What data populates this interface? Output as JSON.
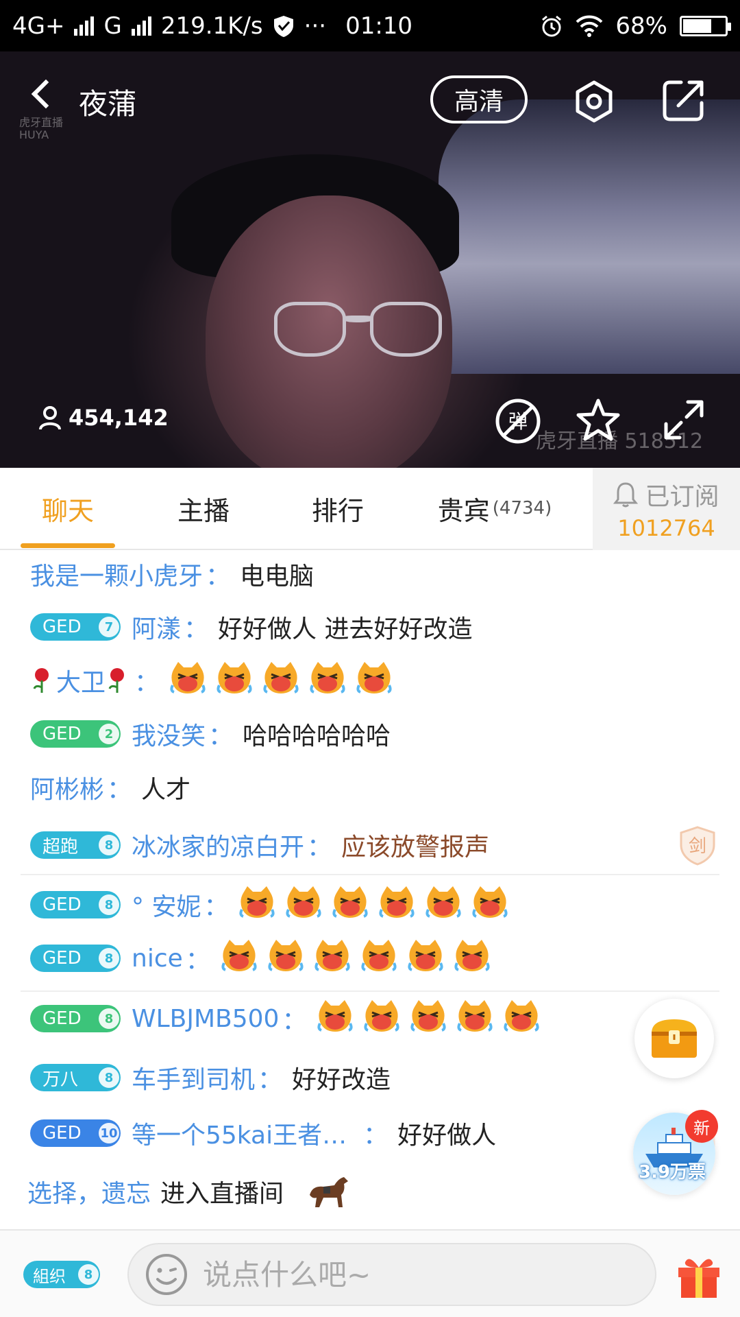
{
  "status_bar": {
    "network1": "4G+",
    "network2": "G",
    "speed": "219.1K/s",
    "more": "···",
    "time": "01:10",
    "battery": "68%",
    "battery_level": 0.68
  },
  "video": {
    "room_title": "夜蒲",
    "quality_label": "高清",
    "viewer_count": "454,142",
    "watermark": "虎牙直播 518512",
    "logo_line1": "虎牙直播",
    "logo_line2": "HUYA"
  },
  "tabs": {
    "items": [
      {
        "label": "聊天"
      },
      {
        "label": "主播"
      },
      {
        "label": "排行"
      },
      {
        "label": "贵宾",
        "count": "(4734)"
      }
    ],
    "subscribe_label": "已订阅",
    "subscribe_count": "1012764"
  },
  "chat": {
    "messages": [
      {
        "user": "我是一颗小虎牙",
        "text": "电电脑"
      },
      {
        "badge": "GED",
        "level": "7",
        "user": "阿漾",
        "text": "好好做人 进去好好改造"
      },
      {
        "user": "大卫",
        "emoji_count": 5
      },
      {
        "badge": "GED",
        "level": "2",
        "user": "我没笑",
        "text": "哈哈哈哈哈哈"
      },
      {
        "user": "阿彬彬",
        "text": "人才"
      },
      {
        "badge": "超跑",
        "level": "8",
        "user": "冰冰家的凉白开",
        "text": "应该放警报声",
        "shield": "剑"
      },
      {
        "badge": "GED",
        "level": "8",
        "user": "°  安妮",
        "emoji_count": 6
      },
      {
        "badge": "GED",
        "level": "8",
        "user": "nice",
        "emoji_count": 6
      },
      {
        "badge": "GED",
        "level": "8",
        "user": "WLBJMB500",
        "emoji_count": 5
      },
      {
        "badge": "万八",
        "level": "8",
        "user": "车手到司机",
        "text": "好好改造"
      },
      {
        "badge": "GED",
        "level": "10",
        "user": "等一个55kai王者…",
        "text": "好好做人"
      },
      {
        "user": "选择，遗忘",
        "text": "进入直播间"
      }
    ],
    "colon": "："
  },
  "floating": {
    "votes": "3.9万票",
    "new_label": "新"
  },
  "bottom": {
    "org_badge": "組织",
    "org_level": "8",
    "input_placeholder": "说点什么吧~"
  }
}
